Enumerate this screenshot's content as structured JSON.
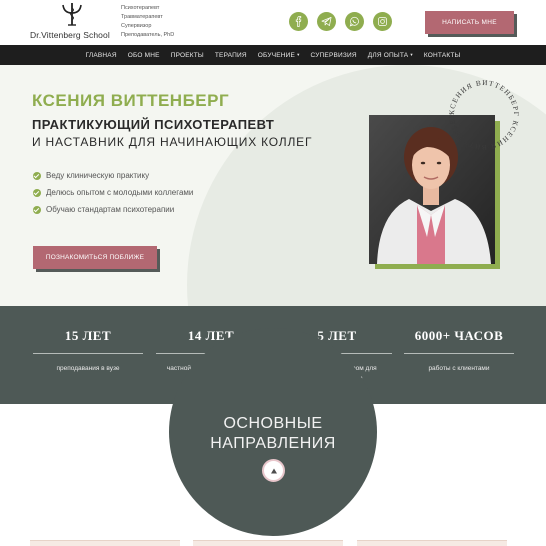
{
  "header": {
    "logo_name": "Dr.Vittenberg School",
    "logo_lines": [
      "Психотерапевт",
      "Травматерапевт",
      "Супервизор",
      "Преподаватель, PhD"
    ],
    "socials": [
      "facebook-icon",
      "telegram-icon",
      "whatsapp-icon",
      "instagram-icon"
    ],
    "cta": "НАПИСАТЬ МНЕ"
  },
  "nav": {
    "items": [
      {
        "label": "ГЛАВНАЯ"
      },
      {
        "label": "ОБО МНЕ"
      },
      {
        "label": "ПРОЕКТЫ"
      },
      {
        "label": "ТЕРАПИЯ"
      },
      {
        "label": "ОБУЧЕНИЕ",
        "dropdown": true
      },
      {
        "label": "СУПЕРВИЗИЯ"
      },
      {
        "label": "ДЛЯ ОПЫТА",
        "dropdown": true
      },
      {
        "label": "КОНТАКТЫ"
      }
    ],
    "caret": "▾"
  },
  "hero": {
    "name": "КСЕНИЯ ВИТТЕНБЕРГ",
    "subtitle1": "ПРАКТИКУЮЩИЙ ПСИХОТЕРАПЕВТ",
    "subtitle2": "И НАСТАВНИК ДЛЯ НАЧИНАЮЩИХ КОЛЛЕГ",
    "bullets": [
      "Веду клиническую практику",
      "Делюсь опытом с молодыми коллегами",
      "Обучаю стандартам психотерапии"
    ],
    "cta": "ПОЗНАКОМИТЬСЯ ПОБЛИЖЕ",
    "circle_text": "КСЕНИЯ ВИТТЕНБЕРГ КСЕНИЯ ВИТТЕНБЕРГ"
  },
  "stats": [
    {
      "value": "15 ЛЕТ",
      "desc": "преподавания в вузе"
    },
    {
      "value": "14 ЛЕТ",
      "desc": "частной практики в группах и индивидуально"
    },
    {
      "value": "5 ЛЕТ",
      "desc": "работы супервизором для психотерапевтов"
    },
    {
      "value": "6000+ ЧАСОВ",
      "desc": "работы с клиентами"
    }
  ],
  "directions": {
    "title_line1": "ОСНОВНЫЕ",
    "title_line2": "НАПРАВЛЕНИЯ"
  },
  "colors": {
    "accent_green": "#8fad4f",
    "accent_rose": "#b36872",
    "dark_slate": "#4e5956",
    "nav_bg": "#1e1e1e"
  }
}
